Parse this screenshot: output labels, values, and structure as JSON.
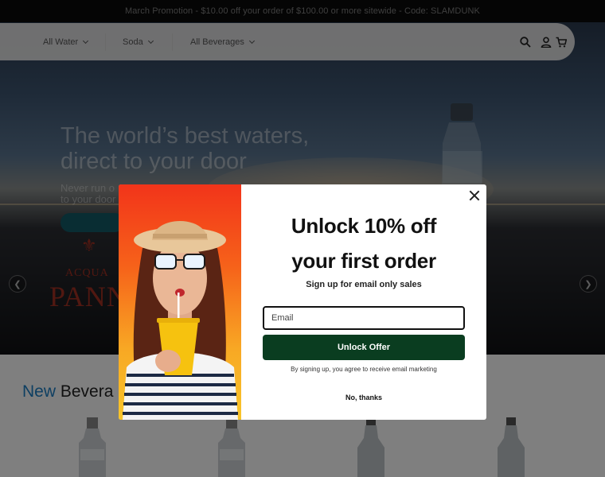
{
  "promo": {
    "text": "March Promotion - $10.00 off your order of $100.00 or more sitewide - Code: SLAMDUNK"
  },
  "nav": {
    "items": [
      {
        "label": "All Water"
      },
      {
        "label": "Soda"
      },
      {
        "label": "All Beverages"
      }
    ],
    "icons": [
      "search-icon",
      "account-icon",
      "cart-icon"
    ]
  },
  "hero": {
    "title_line1": "The world’s best waters,",
    "title_line2": "direct to your door",
    "subtitle_line1": "Never run o",
    "subtitle_line2": "to your door",
    "brand_top": "ACQUA",
    "brand_bottom": "PANN",
    "prev_icon": "chevron-left-icon",
    "next_icon": "chevron-right-icon"
  },
  "section": {
    "title_accent": "New",
    "title_rest": " Bevera"
  },
  "modal": {
    "heading_line1": "Unlock 10% off",
    "heading_line2": "your first order",
    "subtitle": "Sign up for email only sales",
    "email_placeholder": "Email",
    "button_label": "Unlock Offer",
    "disclaimer": "By signing up, you agree to receive email marketing",
    "dismiss_label": "No, thanks",
    "close_icon": "close-icon"
  },
  "colors": {
    "promo_bg": "#0b0b0b",
    "button_bg": "#0a3d20",
    "accent_blue": "#1c7fc4",
    "brand_red": "#a33022"
  }
}
